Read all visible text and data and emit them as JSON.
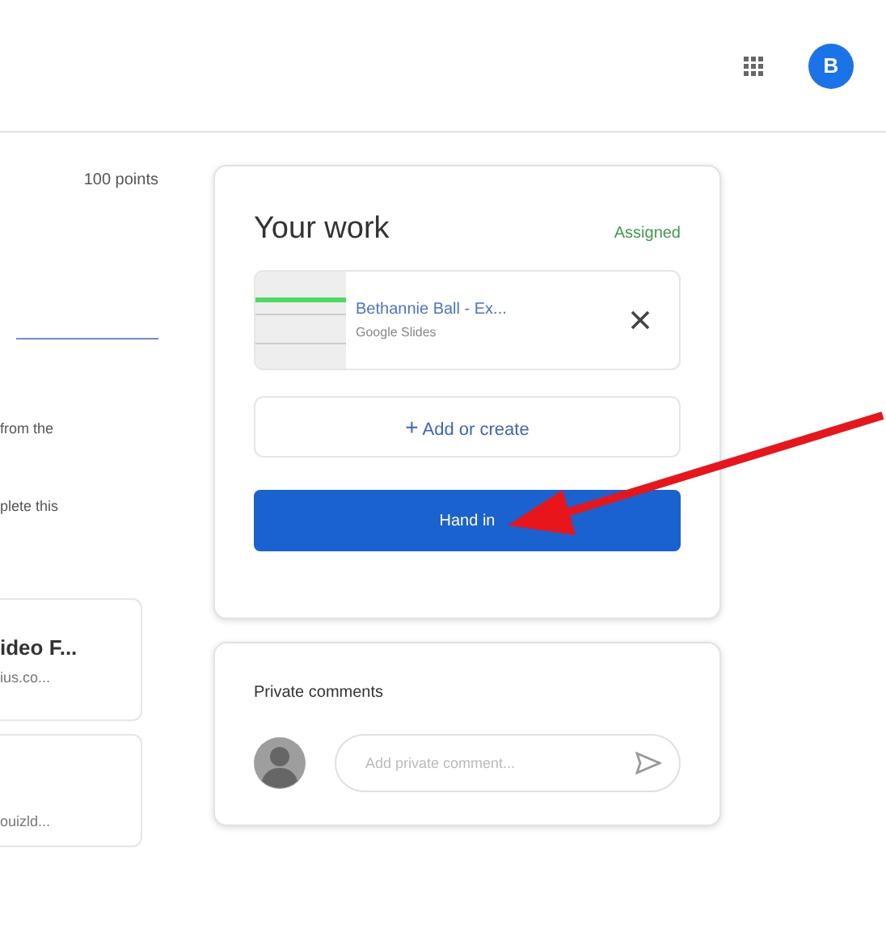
{
  "header": {
    "avatar_letter": "B"
  },
  "assignment": {
    "points": "100 points",
    "description_lines": [
      "from the",
      "plete this"
    ],
    "attachments": [
      {
        "title": "ideo F...",
        "subtitle": "ius.co..."
      },
      {
        "subtitle": "ouizld..."
      }
    ]
  },
  "your_work": {
    "title": "Your work",
    "status": "Assigned",
    "file": {
      "name": "Bethannie Ball - Ex...",
      "type": "Google Slides"
    },
    "add_button": {
      "icon": "+",
      "label": "Add or create"
    },
    "hand_in_button": "Hand in"
  },
  "private_comments": {
    "title": "Private comments",
    "placeholder": "Add private comment..."
  }
}
